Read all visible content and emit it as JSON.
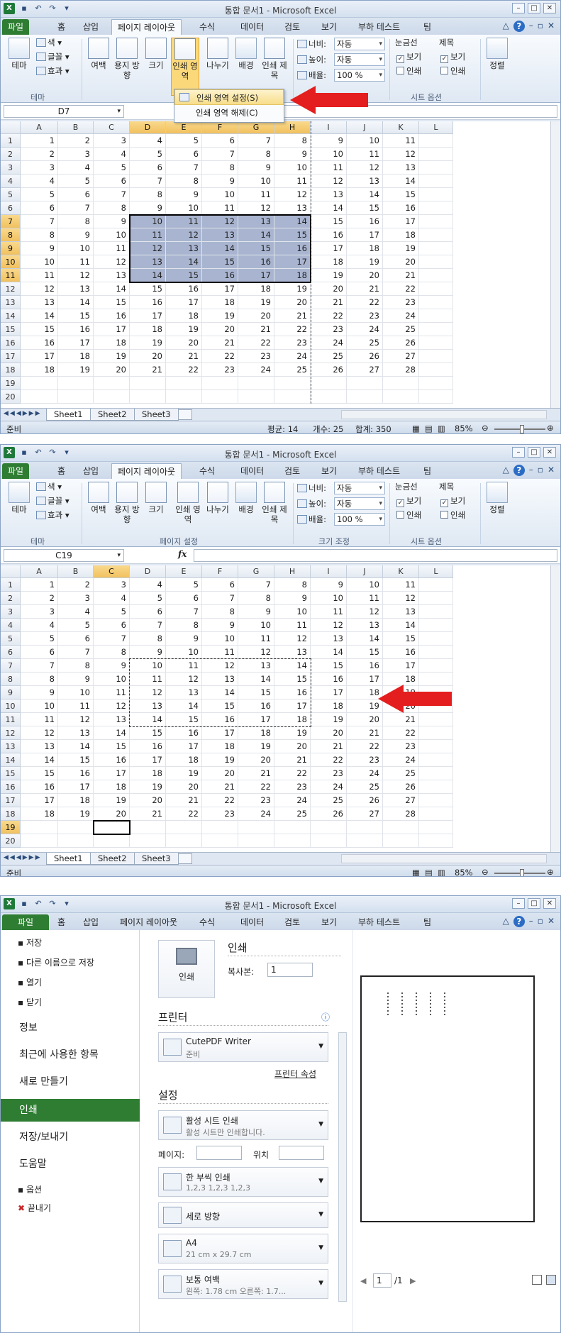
{
  "app": {
    "title": "통합 문서1 - Microsoft Excel",
    "tabs": [
      "파일",
      "홈",
      "삽입",
      "페이지 레이아웃",
      "수식",
      "데이터",
      "검토",
      "보기",
      "부하 테스트",
      "팀"
    ]
  },
  "ribbon": {
    "theme": {
      "label": "테마",
      "colors": "색",
      "fonts": "글꼴",
      "effects": "효과",
      "group": "테마"
    },
    "page_setup": {
      "margins": "여백",
      "orientation": "용지 방향",
      "size": "크기",
      "print_area": "인쇄 영역",
      "breaks": "나누기",
      "background": "배경",
      "print_titles": "인쇄 제목",
      "group": "페이지 설정"
    },
    "scale": {
      "width_label": "너비:",
      "width_value": "자동",
      "height_label": "높이:",
      "height_value": "자동",
      "scale_label": "배율:",
      "scale_value": "100 %",
      "group": "크기 조정"
    },
    "sheet_options": {
      "gridlines": "눈금선",
      "headings": "제목",
      "view": "보기",
      "print": "인쇄",
      "group": "시트 옵션"
    },
    "arrange": "정렬"
  },
  "menu": {
    "set_print_area": "인쇄 영역 설정(S)",
    "clear_print_area": "인쇄 영역 해제(C)"
  },
  "panel1": {
    "namebox": "D7",
    "status": {
      "ready": "준비",
      "average": "평균: 14",
      "count": "개수: 25",
      "sum": "합계: 350",
      "zoom": "85%"
    }
  },
  "panel2": {
    "namebox": "C19",
    "fx": "fx",
    "status": {
      "ready": "준비",
      "zoom": "85%"
    }
  },
  "columns": [
    "A",
    "B",
    "C",
    "D",
    "E",
    "F",
    "G",
    "H",
    "I",
    "J",
    "K",
    "L"
  ],
  "rows": [
    "1",
    "2",
    "3",
    "4",
    "5",
    "6",
    "7",
    "8",
    "9",
    "10",
    "11",
    "12",
    "13",
    "14",
    "15",
    "16",
    "17",
    "18",
    "19",
    "20"
  ],
  "sheets": [
    "Sheet1",
    "Sheet2",
    "Sheet3"
  ],
  "backstage": {
    "nav": [
      "저장",
      "다른 이름으로 저장",
      "열기",
      "닫기",
      "정보",
      "최근에 사용한 항목",
      "새로 만들기",
      "인쇄",
      "저장/보내기",
      "도움말",
      "옵션",
      "끝내기"
    ],
    "print_heading": "인쇄",
    "print_button": "인쇄",
    "copies_label": "복사본:",
    "copies_value": "1",
    "printer_heading": "프린터",
    "printer_name": "CutePDF Writer",
    "printer_status": "준비",
    "printer_props": "프린터 속성",
    "settings_heading": "설정",
    "active_sheets": "활성 시트 인쇄",
    "active_sheets_sub": "활성 시트만 인쇄합니다.",
    "pages_label": "페이지:",
    "to_label": "위치",
    "collated": "한 부씩 인쇄",
    "collated_sub": "1,2,3    1,2,3    1,2,3",
    "orientation": "세로 방향",
    "paper": "A4",
    "paper_sub": "21 cm x 29.7 cm",
    "margins": "보통 여백",
    "margins_sub": "왼쪽: 1.78 cm    오른쪽: 1.7...",
    "page_num": "1",
    "page_total": "/1"
  }
}
